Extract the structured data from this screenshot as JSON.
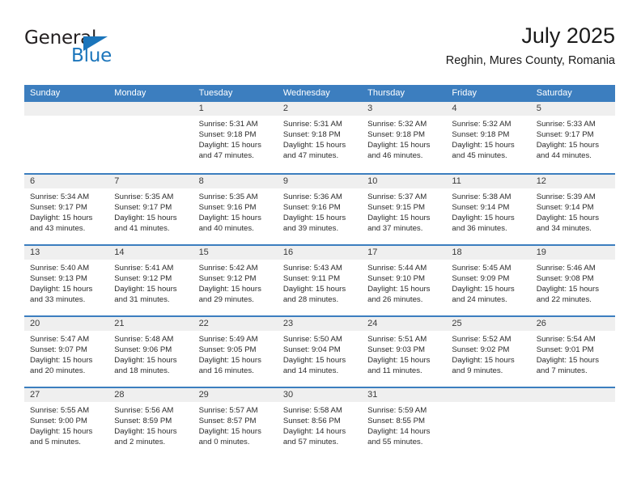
{
  "logo": {
    "text_top": "General",
    "text_bottom": "Blue",
    "icon": "triangle-icon",
    "accent_color": "#1b75bb"
  },
  "header": {
    "title": "July 2025",
    "location": "Reghin, Mures County, Romania"
  },
  "theme": {
    "header_blue": "#3c7ebf",
    "day_band_gray": "#efefef",
    "text": "#2b2b2b"
  },
  "calendar": {
    "weekdays": [
      "Sunday",
      "Monday",
      "Tuesday",
      "Wednesday",
      "Thursday",
      "Friday",
      "Saturday"
    ],
    "weeks": [
      [
        {
          "day": "",
          "lines": []
        },
        {
          "day": "",
          "lines": []
        },
        {
          "day": "1",
          "lines": [
            "Sunrise: 5:31 AM",
            "Sunset: 9:18 PM",
            "Daylight: 15 hours",
            "and 47 minutes."
          ]
        },
        {
          "day": "2",
          "lines": [
            "Sunrise: 5:31 AM",
            "Sunset: 9:18 PM",
            "Daylight: 15 hours",
            "and 47 minutes."
          ]
        },
        {
          "day": "3",
          "lines": [
            "Sunrise: 5:32 AM",
            "Sunset: 9:18 PM",
            "Daylight: 15 hours",
            "and 46 minutes."
          ]
        },
        {
          "day": "4",
          "lines": [
            "Sunrise: 5:32 AM",
            "Sunset: 9:18 PM",
            "Daylight: 15 hours",
            "and 45 minutes."
          ]
        },
        {
          "day": "5",
          "lines": [
            "Sunrise: 5:33 AM",
            "Sunset: 9:17 PM",
            "Daylight: 15 hours",
            "and 44 minutes."
          ]
        }
      ],
      [
        {
          "day": "6",
          "lines": [
            "Sunrise: 5:34 AM",
            "Sunset: 9:17 PM",
            "Daylight: 15 hours",
            "and 43 minutes."
          ]
        },
        {
          "day": "7",
          "lines": [
            "Sunrise: 5:35 AM",
            "Sunset: 9:17 PM",
            "Daylight: 15 hours",
            "and 41 minutes."
          ]
        },
        {
          "day": "8",
          "lines": [
            "Sunrise: 5:35 AM",
            "Sunset: 9:16 PM",
            "Daylight: 15 hours",
            "and 40 minutes."
          ]
        },
        {
          "day": "9",
          "lines": [
            "Sunrise: 5:36 AM",
            "Sunset: 9:16 PM",
            "Daylight: 15 hours",
            "and 39 minutes."
          ]
        },
        {
          "day": "10",
          "lines": [
            "Sunrise: 5:37 AM",
            "Sunset: 9:15 PM",
            "Daylight: 15 hours",
            "and 37 minutes."
          ]
        },
        {
          "day": "11",
          "lines": [
            "Sunrise: 5:38 AM",
            "Sunset: 9:14 PM",
            "Daylight: 15 hours",
            "and 36 minutes."
          ]
        },
        {
          "day": "12",
          "lines": [
            "Sunrise: 5:39 AM",
            "Sunset: 9:14 PM",
            "Daylight: 15 hours",
            "and 34 minutes."
          ]
        }
      ],
      [
        {
          "day": "13",
          "lines": [
            "Sunrise: 5:40 AM",
            "Sunset: 9:13 PM",
            "Daylight: 15 hours",
            "and 33 minutes."
          ]
        },
        {
          "day": "14",
          "lines": [
            "Sunrise: 5:41 AM",
            "Sunset: 9:12 PM",
            "Daylight: 15 hours",
            "and 31 minutes."
          ]
        },
        {
          "day": "15",
          "lines": [
            "Sunrise: 5:42 AM",
            "Sunset: 9:12 PM",
            "Daylight: 15 hours",
            "and 29 minutes."
          ]
        },
        {
          "day": "16",
          "lines": [
            "Sunrise: 5:43 AM",
            "Sunset: 9:11 PM",
            "Daylight: 15 hours",
            "and 28 minutes."
          ]
        },
        {
          "day": "17",
          "lines": [
            "Sunrise: 5:44 AM",
            "Sunset: 9:10 PM",
            "Daylight: 15 hours",
            "and 26 minutes."
          ]
        },
        {
          "day": "18",
          "lines": [
            "Sunrise: 5:45 AM",
            "Sunset: 9:09 PM",
            "Daylight: 15 hours",
            "and 24 minutes."
          ]
        },
        {
          "day": "19",
          "lines": [
            "Sunrise: 5:46 AM",
            "Sunset: 9:08 PM",
            "Daylight: 15 hours",
            "and 22 minutes."
          ]
        }
      ],
      [
        {
          "day": "20",
          "lines": [
            "Sunrise: 5:47 AM",
            "Sunset: 9:07 PM",
            "Daylight: 15 hours",
            "and 20 minutes."
          ]
        },
        {
          "day": "21",
          "lines": [
            "Sunrise: 5:48 AM",
            "Sunset: 9:06 PM",
            "Daylight: 15 hours",
            "and 18 minutes."
          ]
        },
        {
          "day": "22",
          "lines": [
            "Sunrise: 5:49 AM",
            "Sunset: 9:05 PM",
            "Daylight: 15 hours",
            "and 16 minutes."
          ]
        },
        {
          "day": "23",
          "lines": [
            "Sunrise: 5:50 AM",
            "Sunset: 9:04 PM",
            "Daylight: 15 hours",
            "and 14 minutes."
          ]
        },
        {
          "day": "24",
          "lines": [
            "Sunrise: 5:51 AM",
            "Sunset: 9:03 PM",
            "Daylight: 15 hours",
            "and 11 minutes."
          ]
        },
        {
          "day": "25",
          "lines": [
            "Sunrise: 5:52 AM",
            "Sunset: 9:02 PM",
            "Daylight: 15 hours",
            "and 9 minutes."
          ]
        },
        {
          "day": "26",
          "lines": [
            "Sunrise: 5:54 AM",
            "Sunset: 9:01 PM",
            "Daylight: 15 hours",
            "and 7 minutes."
          ]
        }
      ],
      [
        {
          "day": "27",
          "lines": [
            "Sunrise: 5:55 AM",
            "Sunset: 9:00 PM",
            "Daylight: 15 hours",
            "and 5 minutes."
          ]
        },
        {
          "day": "28",
          "lines": [
            "Sunrise: 5:56 AM",
            "Sunset: 8:59 PM",
            "Daylight: 15 hours",
            "and 2 minutes."
          ]
        },
        {
          "day": "29",
          "lines": [
            "Sunrise: 5:57 AM",
            "Sunset: 8:57 PM",
            "Daylight: 15 hours",
            "and 0 minutes."
          ]
        },
        {
          "day": "30",
          "lines": [
            "Sunrise: 5:58 AM",
            "Sunset: 8:56 PM",
            "Daylight: 14 hours",
            "and 57 minutes."
          ]
        },
        {
          "day": "31",
          "lines": [
            "Sunrise: 5:59 AM",
            "Sunset: 8:55 PM",
            "Daylight: 14 hours",
            "and 55 minutes."
          ]
        },
        {
          "day": "",
          "lines": []
        },
        {
          "day": "",
          "lines": []
        }
      ]
    ]
  }
}
